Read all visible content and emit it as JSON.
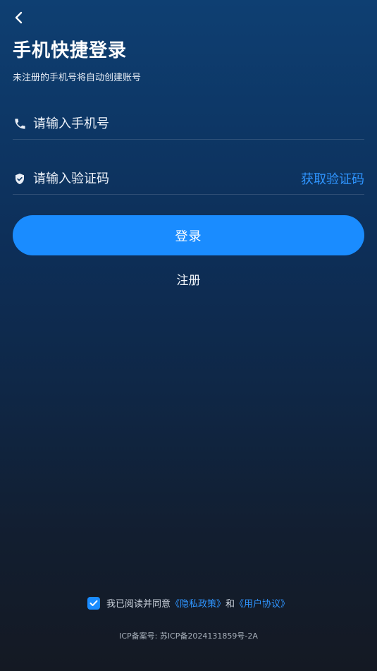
{
  "header": {
    "back_icon": "chevron-left-icon",
    "title": "手机快捷登录",
    "subtitle": "未注册的手机号将自动创建账号"
  },
  "form": {
    "phone": {
      "icon": "phone-icon",
      "placeholder": "请输入手机号",
      "value": ""
    },
    "code": {
      "icon": "shield-check-icon",
      "placeholder": "请输入验证码",
      "value": "",
      "get_code_label": "获取验证码"
    },
    "login_label": "登录",
    "register_label": "注册"
  },
  "agreement": {
    "checked": true,
    "prefix": "我已阅读并同意",
    "privacy_link": "《隐私政策》",
    "and": "和",
    "terms_link": "《用户协议》"
  },
  "footer": {
    "icp": "ICP备案号: 苏ICP备2024131859号-2A"
  },
  "colors": {
    "accent": "#1a8cff",
    "link": "#2f95ff",
    "background_top": "#0e3f72",
    "background_bottom": "#141923"
  }
}
